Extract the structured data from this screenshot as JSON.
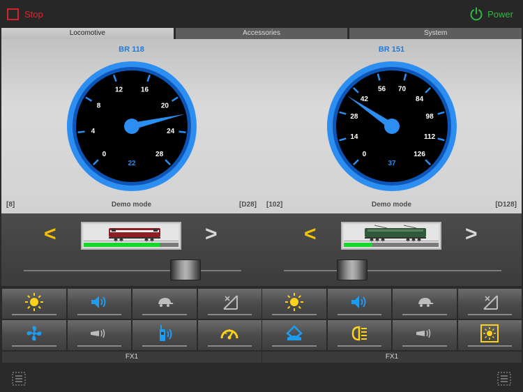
{
  "header": {
    "stop_label": "Stop",
    "power_label": "Power"
  },
  "tabs": [
    {
      "label": "Locomotive",
      "active": true
    },
    {
      "label": "Accessories",
      "active": false
    },
    {
      "label": "System",
      "active": false
    }
  ],
  "locos": [
    {
      "name": "BR 118",
      "speed": "22",
      "speed_value": 22,
      "max": 28,
      "ticks": [
        "0",
        "4",
        "8",
        "12",
        "16",
        "20",
        "24",
        "28"
      ],
      "address": "[8]",
      "mode": "Demo mode",
      "dcc": "[D28]",
      "progress": 0.8,
      "image_name": "br118-locomotive-image",
      "functions": [
        "light-icon",
        "sound-icon",
        "shunting-turtle-icon",
        "no-brake-icon",
        "fan-icon",
        "horn-icon",
        "radio-icon",
        "speedometer-icon"
      ],
      "fx_label": "FX1"
    },
    {
      "name": "BR 151",
      "speed": "37",
      "speed_value": 37,
      "max": 126,
      "ticks": [
        "0",
        "14",
        "28",
        "42",
        "56",
        "70",
        "84",
        "98",
        "112",
        "126"
      ],
      "address": "[102]",
      "mode": "Demo mode",
      "dcc": "[D128]",
      "progress": 0.3,
      "image_name": "br151-locomotive-image",
      "functions": [
        "light-icon",
        "sound-icon",
        "shunting-turtle-icon",
        "no-brake-icon",
        "pantograph-icon",
        "headlight-icon",
        "horn-icon",
        "cabin-light-icon"
      ],
      "fx_label": "FX1"
    }
  ],
  "colors": {
    "accent_blue": "#1f7bd6",
    "stop_red": "#e0242f",
    "power_green": "#33b944",
    "icon_yellow": "#ffd21a",
    "icon_blue": "#1e9cf0",
    "progress_green": "#18d62c"
  },
  "icons": {
    "stop": "stop-square-icon",
    "power": "power-icon",
    "list": "list-icon"
  }
}
